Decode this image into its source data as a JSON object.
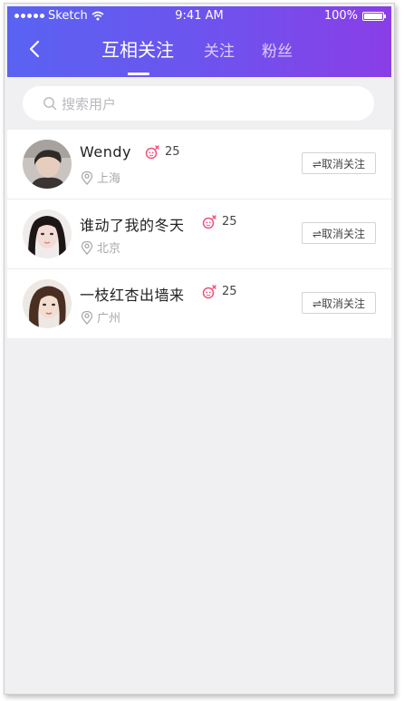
{
  "status_bar": {
    "carrier": "Sketch",
    "time": "9:41 AM",
    "battery": "100%",
    "battery_level": 1.0
  },
  "header": {
    "back_icon": "chevron-left-icon",
    "tabs": [
      {
        "label": "互相关注",
        "active": true
      },
      {
        "label": "关注",
        "active": false
      },
      {
        "label": "粉丝",
        "active": false
      }
    ]
  },
  "search": {
    "placeholder": "搜索用户",
    "icon": "search-icon"
  },
  "users": [
    {
      "name": "Wendy",
      "gender_icon": "female-icon",
      "count": "25",
      "location": "上海",
      "button": "⇌取消关注"
    },
    {
      "name": "谁动了我的冬天",
      "gender_icon": "female-icon",
      "count": "25",
      "location": "北京",
      "button": "⇌取消关注"
    },
    {
      "name": "一枝红杏出墙来",
      "gender_icon": "female-icon",
      "count": "25",
      "location": "广州",
      "button": "⇌取消关注"
    }
  ],
  "colors": {
    "header_gradient_start": "#5963f2",
    "header_gradient_end": "#8a3ee6",
    "gender_accent": "#f0507a",
    "background": "#f0f0f2"
  }
}
